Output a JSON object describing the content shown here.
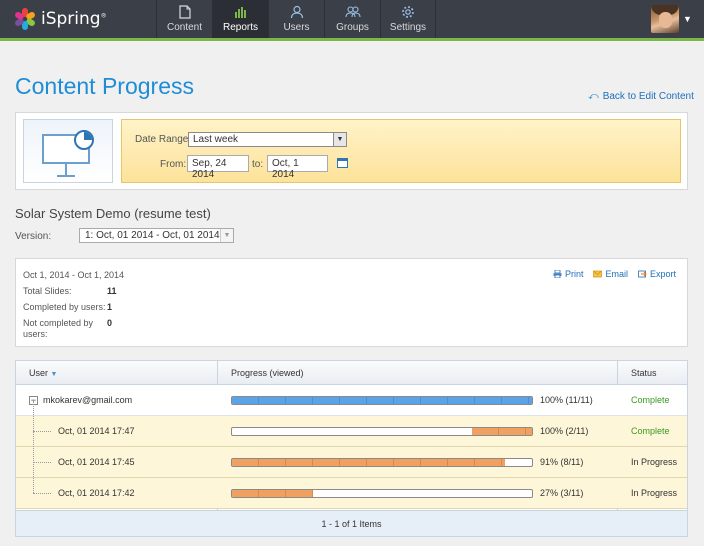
{
  "app": {
    "name": "iSpring",
    "trademark": "®"
  },
  "nav": [
    {
      "label": "Content",
      "icon": "document-icon",
      "active": false
    },
    {
      "label": "Reports",
      "icon": "bar-chart-icon",
      "active": true
    },
    {
      "label": "Users",
      "icon": "user-icon",
      "active": false
    },
    {
      "label": "Groups",
      "icon": "group-icon",
      "active": false
    },
    {
      "label": "Settings",
      "icon": "gear-icon",
      "active": false
    }
  ],
  "page": {
    "title": "Content Progress",
    "back_link": "Back to Edit Content"
  },
  "filters": {
    "date_range_label": "Date Range:",
    "date_range_value": "Last week",
    "from_label": "From:",
    "from_value": "Sep, 24 2014",
    "to_label": "to:",
    "to_value": "Oct, 1 2014"
  },
  "course": {
    "title": "Solar System Demo (resume test)",
    "version_label": "Version:",
    "version_value": "1: Oct, 01 2014 - Oct, 01 2014"
  },
  "summary": {
    "range": "Oct 1, 2014 - Oct 1, 2014",
    "total_slides_label": "Total Slides:",
    "total_slides": "11",
    "completed_label": "Completed by users:",
    "completed": "1",
    "not_completed_label_1": "Not completed by",
    "not_completed_label_2": "users:",
    "not_completed": "0",
    "actions": {
      "print": "Print",
      "email": "Email",
      "export": "Export"
    }
  },
  "table": {
    "headers": {
      "user": "User",
      "progress": "Progress (viewed)",
      "status": "Status"
    },
    "rows": [
      {
        "user": "mkokarev@gmail.com",
        "progress": 1.0,
        "progress_text": "100% (11/11)",
        "status": "Complete",
        "color": "#5aa3e6"
      },
      {
        "user": "Oct, 01 2014 17:47",
        "progress": 1.0,
        "progress_text": "100% (2/11)",
        "status": "Complete",
        "color": "#f0a060"
      },
      {
        "user": "Oct, 01 2014 17:45",
        "progress": 0.91,
        "progress_text": "91% (8/11)",
        "status": "In Progress",
        "color": "#f0a060"
      },
      {
        "user": "Oct, 01 2014 17:42",
        "progress": 0.27,
        "progress_text": "27% (3/11)",
        "status": "In Progress",
        "color": "#f0a060"
      }
    ],
    "footer": "1 - 1 of 1 Items"
  },
  "colors": {
    "accent": "#1f8dd6",
    "topbar": "#3b3f47",
    "green_line": "#7ab648",
    "complete": "#3a9a20"
  }
}
